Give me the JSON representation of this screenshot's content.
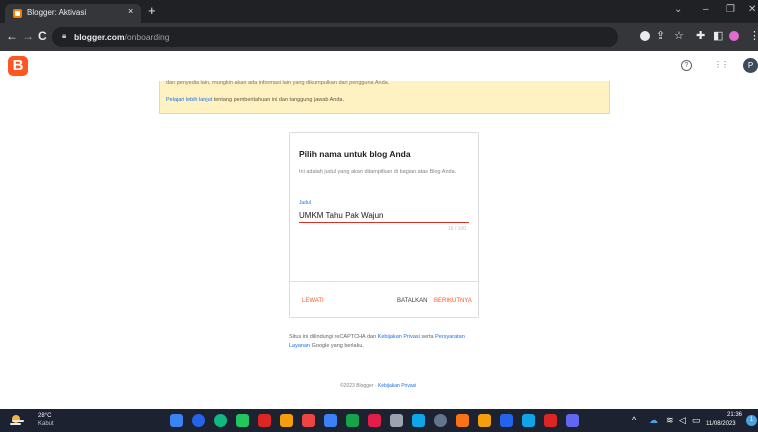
{
  "browser": {
    "tab_title": "Blogger: Aktivasi",
    "tab_close": "×",
    "new_tab": "+",
    "url_host": "blogger.com",
    "url_path": "/onboarding",
    "window_controls": [
      "⌄",
      "–",
      "❐",
      "✕"
    ],
    "nav": {
      "back": "←",
      "forward": "→",
      "reload": "C"
    }
  },
  "header": {
    "logo_letter": "B",
    "help_glyph": "?",
    "apps_glyph": "⋮⋮",
    "avatar_letter": "P"
  },
  "notice": {
    "top_text": "dan penyedia lain, mungkin akan ada informasi lain yang dikumpulkan dari pengguna Anda.",
    "link_text": "Pelajari lebih lanjut",
    "rest_text": " tentang pemberitahuan ini dan tanggung jawab Anda."
  },
  "dialog": {
    "title": "Pilih nama untuk blog Anda",
    "description": "Ini adalah judul yang akan ditampilkan di bagian atas Blog Anda.",
    "field_label": "Judul",
    "field_value": "UMKM Tahu Pak Wajun",
    "counter": "19 / 100",
    "skip": "LEWATI",
    "cancel": "BATALKAN",
    "next": "BERIKUTNYA"
  },
  "recaptcha": {
    "part1": "Situs ini dilindungi reCAPTCHA dan ",
    "privacy": "Kebijakan Privasi",
    "part2": " serta ",
    "terms": "Persyaratan Layanan",
    "part3": " Google yang berlaku."
  },
  "footer": {
    "copyright": "©2023 Blogger · ",
    "privacy": "Kebijakan Privasi"
  },
  "taskbar": {
    "temp": "28°C",
    "condition": "Kabut",
    "time": "21:36",
    "date": "11/08/2023",
    "notification_count": "1",
    "app_colors": [
      "#3b82f6",
      "#2563eb",
      "#10b981",
      "#22c55e",
      "#dc2626",
      "#f59e0b",
      "#ef4444",
      "#3b82f6",
      "#16a34a",
      "#e11d48",
      "#9ca3af",
      "#0ea5e9",
      "#64748b",
      "#f97316",
      "#f59e0b",
      "#2563eb",
      "#0ea5e9",
      "#dc2626",
      "#6366f1"
    ]
  }
}
